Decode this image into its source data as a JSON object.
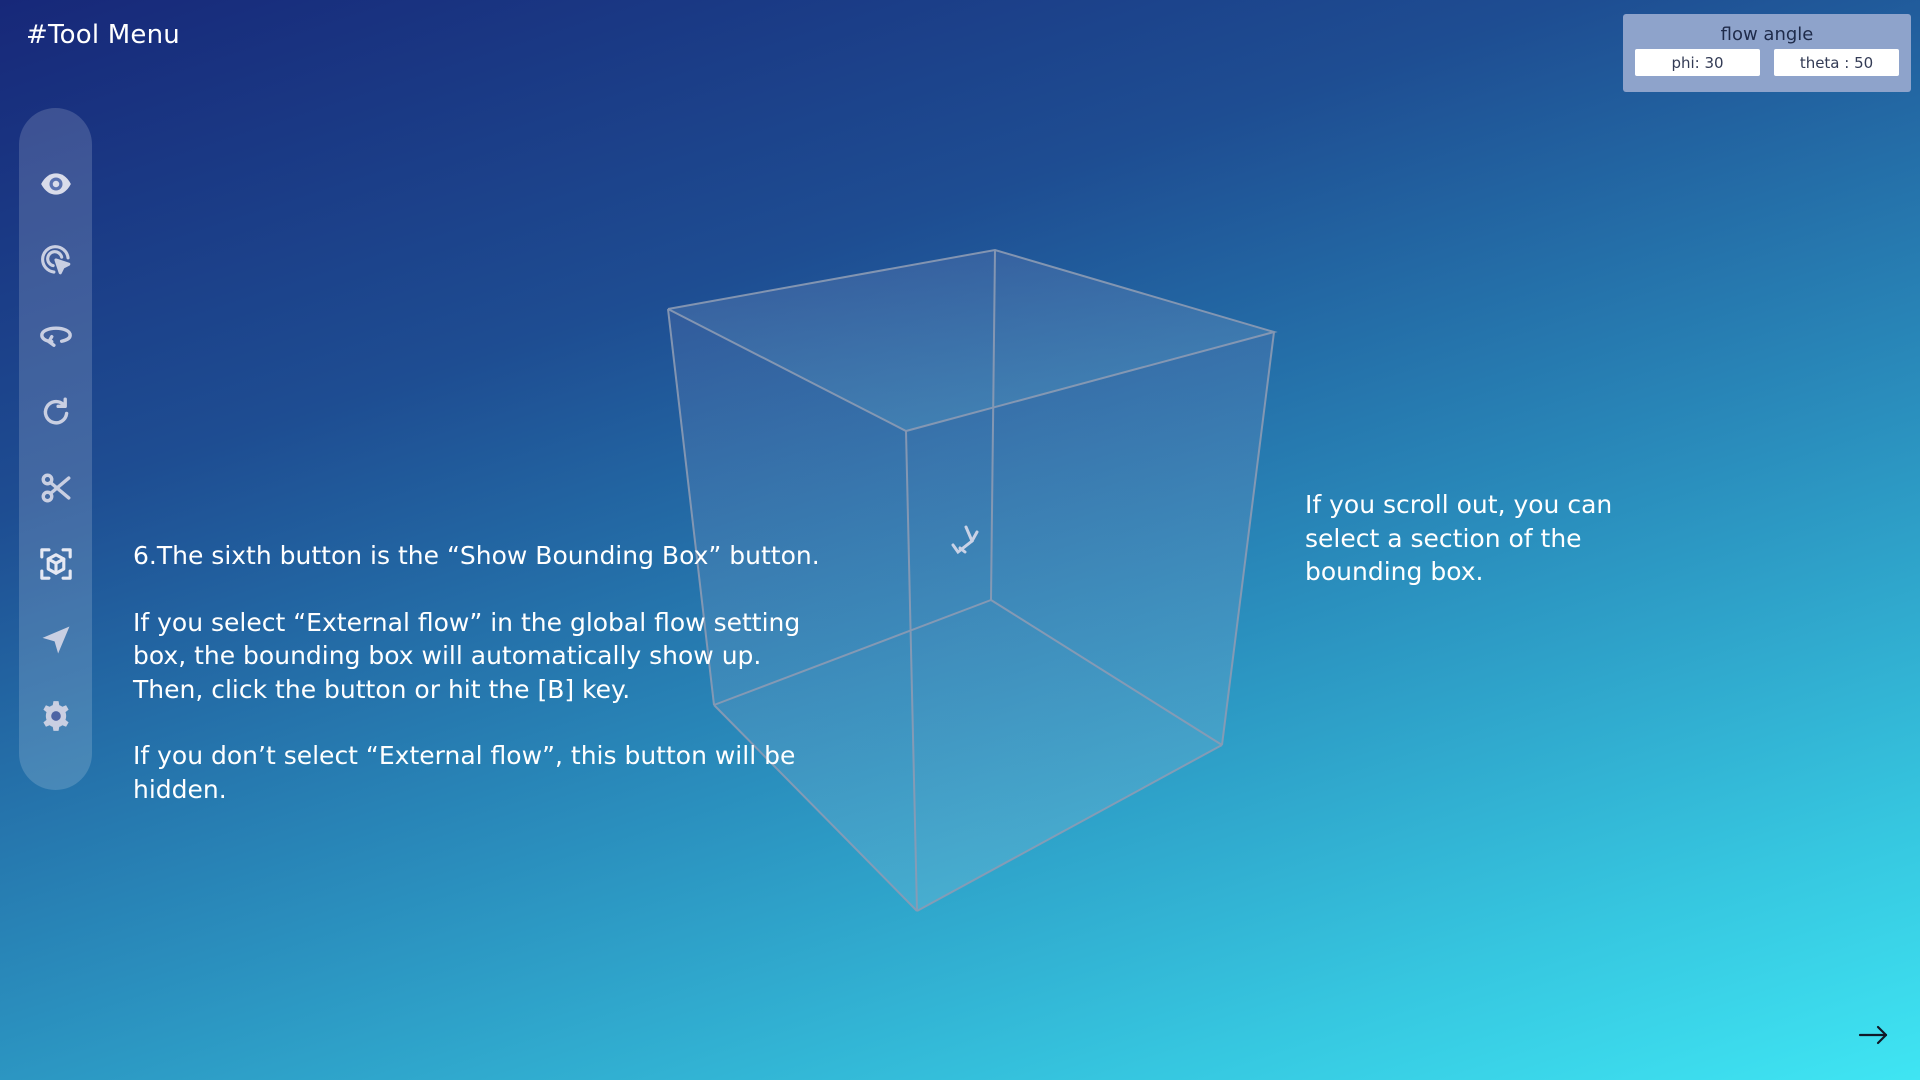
{
  "page": {
    "title": "#Tool Menu"
  },
  "toolbar": {
    "buttons": [
      {
        "icon": "eye-icon"
      },
      {
        "icon": "cursor-click-icon"
      },
      {
        "icon": "rotate-arrow-icon"
      },
      {
        "icon": "refresh-icon"
      },
      {
        "icon": "scissors-icon"
      },
      {
        "icon": "bounding-box-icon"
      },
      {
        "icon": "send-arrow-icon"
      },
      {
        "icon": "gear-icon"
      }
    ]
  },
  "flow_angle": {
    "title": "flow angle",
    "phi": "phi: 30",
    "theta": "theta : 50"
  },
  "instructions": {
    "para1": "6.The sixth button is the “Show Bounding Box” button.",
    "para2_lines": [
      "If you select “External flow” in the global flow setting",
      "box, the bounding box will automatically show up.",
      "Then, click the button or hit the [B] key."
    ],
    "para3_lines": [
      "If you don’t select “External flow”, this button will be",
      "hidden."
    ]
  },
  "side_note": {
    "lines": [
      "If you scroll out, you can",
      "select a section of the",
      "bounding box."
    ]
  },
  "navigation": {
    "next_icon": "arrow-right-icon"
  },
  "colors": {
    "background_top": "#172879",
    "background_bottom": "#3fe5f3",
    "flow_panel": "#8ea3cb",
    "cube_edge": "#8c9bb4"
  }
}
